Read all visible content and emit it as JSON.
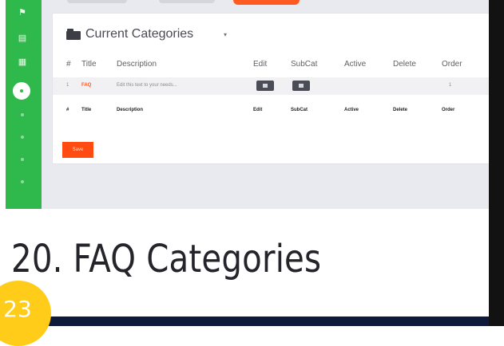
{
  "panel": {
    "title": "Current Categories",
    "caret": "▾",
    "columns": [
      "#",
      "Title",
      "Description",
      "Edit",
      "SubCat",
      "Active",
      "Delete",
      "Order"
    ],
    "rows": [
      {
        "num": "1",
        "title": "FAQ",
        "description": "Edit this text to your needs...",
        "order": "1"
      }
    ],
    "footer": [
      "#",
      "Title",
      "Description",
      "Edit",
      "SubCat",
      "Active",
      "Delete",
      "Order"
    ],
    "save_label": "Save"
  },
  "caption": "20. FAQ Categories",
  "badge": "23",
  "colors": {
    "accent": "#ff5a1f",
    "sidebar": "#2fb84c",
    "badge": "#ffcc19"
  }
}
